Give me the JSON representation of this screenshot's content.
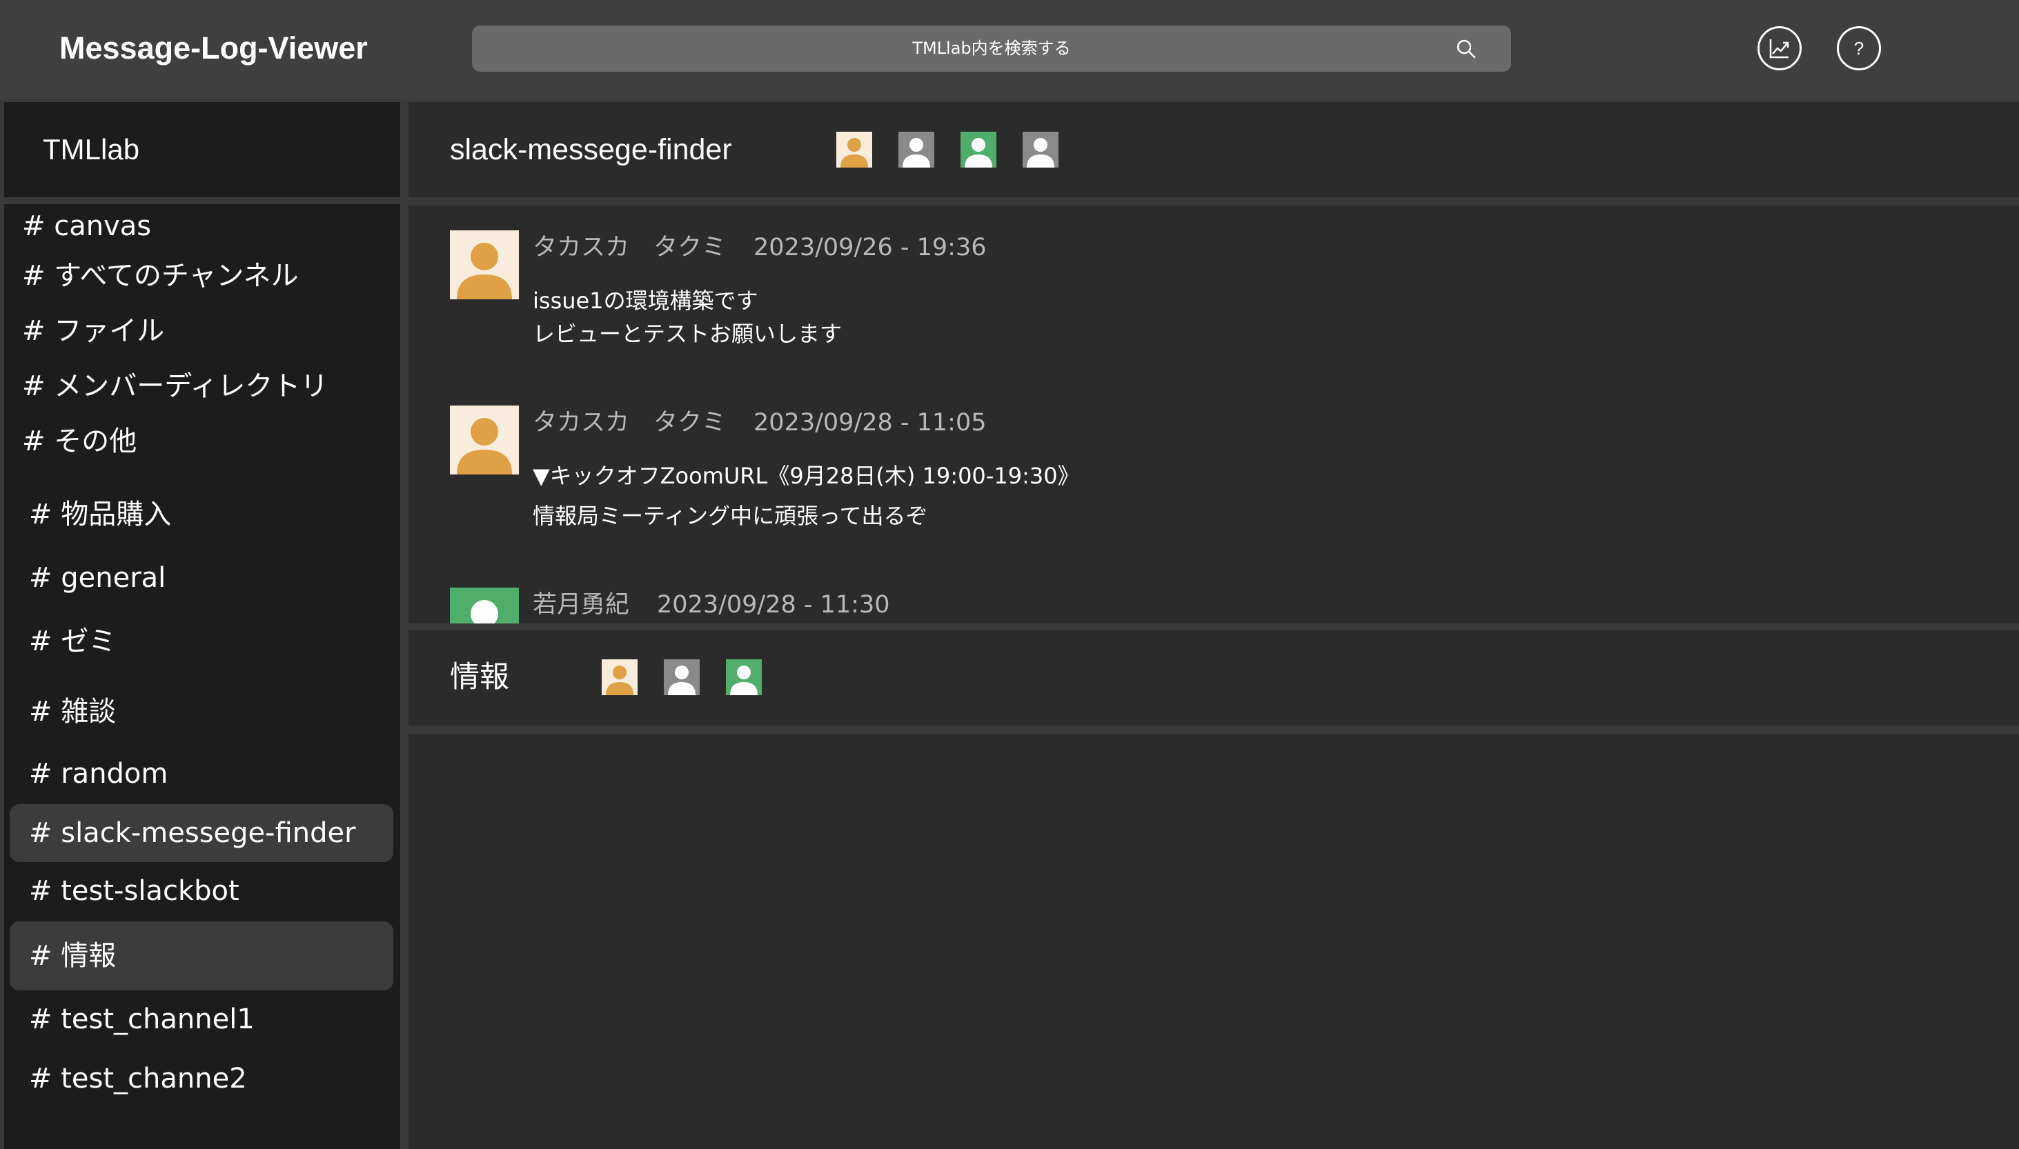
{
  "header": {
    "app_title": "Message-Log-Viewer",
    "search_placeholder": "TMLlab内を検索する",
    "search_icon": "search-icon",
    "analytics_icon": "chart-trend-icon",
    "help_label": "?"
  },
  "sidebar": {
    "workspace": "TMLlab",
    "nav_items": [
      {
        "label": "# canvas"
      },
      {
        "label": "# すべてのチャンネル"
      },
      {
        "label": "# ファイル"
      },
      {
        "label": "# メンバーディレクトリ"
      },
      {
        "label": "# その他"
      }
    ],
    "channels": [
      {
        "label": "# 物品購入",
        "active": false
      },
      {
        "label": "# general",
        "active": false
      },
      {
        "label": "# ゼミ",
        "active": false
      },
      {
        "label": "# 雑談",
        "active": false
      },
      {
        "label": "# random",
        "active": false
      },
      {
        "label": "# slack-messege-finder",
        "active": true
      },
      {
        "label": "# test-slackbot",
        "active": false
      },
      {
        "label": "# 情報",
        "active": true
      },
      {
        "label": "# test_channel1",
        "active": false
      },
      {
        "label": "# test_channe2",
        "active": false
      }
    ]
  },
  "channel_panels": [
    {
      "title": "slack-messege-finder",
      "member_avatars": [
        {
          "color": "#e0a044"
        },
        {
          "color": "#8a8a8a"
        },
        {
          "color": "#4fae6a"
        },
        {
          "color": "#8a8a8a"
        }
      ],
      "messages": [
        {
          "sender": "タカスカ　タクミ",
          "timestamp": "2023/09/26 - 19:36",
          "avatar_color": "#e0a044",
          "lines": [
            "issue1の環境構築です",
            "レビューとテストお願いします"
          ]
        },
        {
          "sender": "タカスカ　タクミ",
          "timestamp": "2023/09/28 - 11:05",
          "avatar_color": "#e0a044",
          "lines": [
            "▼キックオフZoomURL《9月28日(木) 19:00-19:30》",
            "情報局ミーティング中に頑張って出るぞ"
          ]
        },
        {
          "sender": "若月勇紀",
          "timestamp": "2023/09/28 - 11:30",
          "avatar_color": "#4fae6a",
          "lines": []
        }
      ]
    },
    {
      "title": "情報",
      "member_avatars": [
        {
          "color": "#e0a044"
        },
        {
          "color": "#8a8a8a"
        },
        {
          "color": "#4fae6a"
        }
      ]
    }
  ],
  "colors": {
    "background": "#3a3a3a",
    "header": "#3f3f3f",
    "sidebar_panel": "#1c1c1c",
    "main_panel": "#2b2b2b",
    "active_channel": "#3c3c3c",
    "search_bar": "#6a6a6a",
    "orange_user": "#e0a044",
    "gray_user": "#8a8a8a",
    "green_user": "#4fae6a"
  }
}
